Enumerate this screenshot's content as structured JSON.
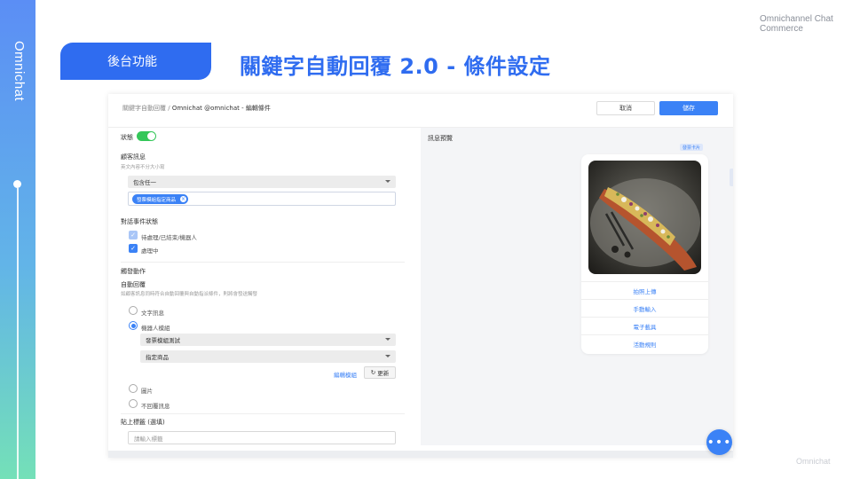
{
  "slide": {
    "brand": "Omnichat",
    "corner_text_line1": "Omnichannel Chat",
    "corner_text_line2": "Commerce",
    "section_tag": "後台功能",
    "title": "關鍵字自動回覆 2.0 - 條件設定",
    "footer_logo": "Omnichat"
  },
  "app": {
    "breadcrumb_parent": "關鍵字自動回覆 /",
    "breadcrumb_current": "Omnichat @omnichat - 編輯條件",
    "cancel_label": "取消",
    "save_label": "儲存",
    "status_label": "狀態",
    "customer_message_label": "顧客訊息",
    "customer_message_hint": "英文內容不分大小寫",
    "match_select_value": "包含任一",
    "keyword_chip": "發票模組指定商品",
    "conversation_status_label": "對話事件狀態",
    "status_option_1": "待處理/已結束/機器人",
    "status_option_2": "處理中",
    "trigger_action_label": "觸發動作",
    "auto_reply_label": "自動回覆",
    "auto_reply_hint": "如顧客訊息同時符合自動回覆與自動指派條件，則將會發送觸發",
    "reply_options": [
      "文字訊息",
      "機器人模組",
      "圖片",
      "不回覆訊息"
    ],
    "bot_module_select": "發票模組測試",
    "product_select": "指定商品",
    "edit_module_link": "編輯模組",
    "refresh_label": "更新",
    "tag_label": "貼上標籤 (選填)",
    "tag_placeholder": "請輸入標籤"
  },
  "preview": {
    "title": "訊息預覽",
    "badge": "發票卡片",
    "buttons": [
      "拍照上傳",
      "手動輸入",
      "電子載具",
      "活動規則"
    ]
  },
  "colors": {
    "brand_blue": "#2f6cf0",
    "accent_blue": "#3b82f6",
    "toggle_green": "#34c759"
  },
  "status_toggle_on": true
}
